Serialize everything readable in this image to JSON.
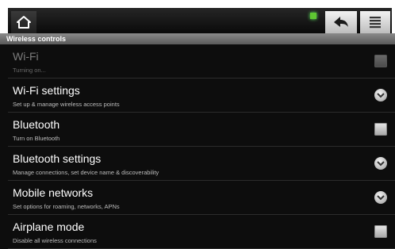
{
  "toolbar": {
    "home_icon": "home-icon",
    "back_icon": "back-arrow-icon",
    "menu_icon": "menu-list-icon",
    "status_indicator_color": "#5fc832"
  },
  "section": {
    "header": "Wireless controls"
  },
  "items": [
    {
      "title": "Wi-Fi",
      "summary": "Turning on...",
      "control": "checkbox",
      "enabled": false,
      "checked": false
    },
    {
      "title": "Wi-Fi settings",
      "summary": "Set up & manage wireless access points",
      "control": "chevron"
    },
    {
      "title": "Bluetooth",
      "summary": "Turn on Bluetooth",
      "control": "checkbox",
      "enabled": true,
      "checked": false
    },
    {
      "title": "Bluetooth settings",
      "summary": "Manage connections, set device name & discoverability",
      "control": "chevron"
    },
    {
      "title": "Mobile networks",
      "summary": "Set options for roaming, networks, APNs",
      "control": "chevron"
    },
    {
      "title": "Airplane mode",
      "summary": "Disable all wireless connections",
      "control": "checkbox",
      "enabled": true,
      "checked": false
    }
  ],
  "colors": {
    "background": "#0d0d0d",
    "header": "#6e6e6e",
    "text": "#ffffff",
    "summary": "#bdbdbd"
  }
}
